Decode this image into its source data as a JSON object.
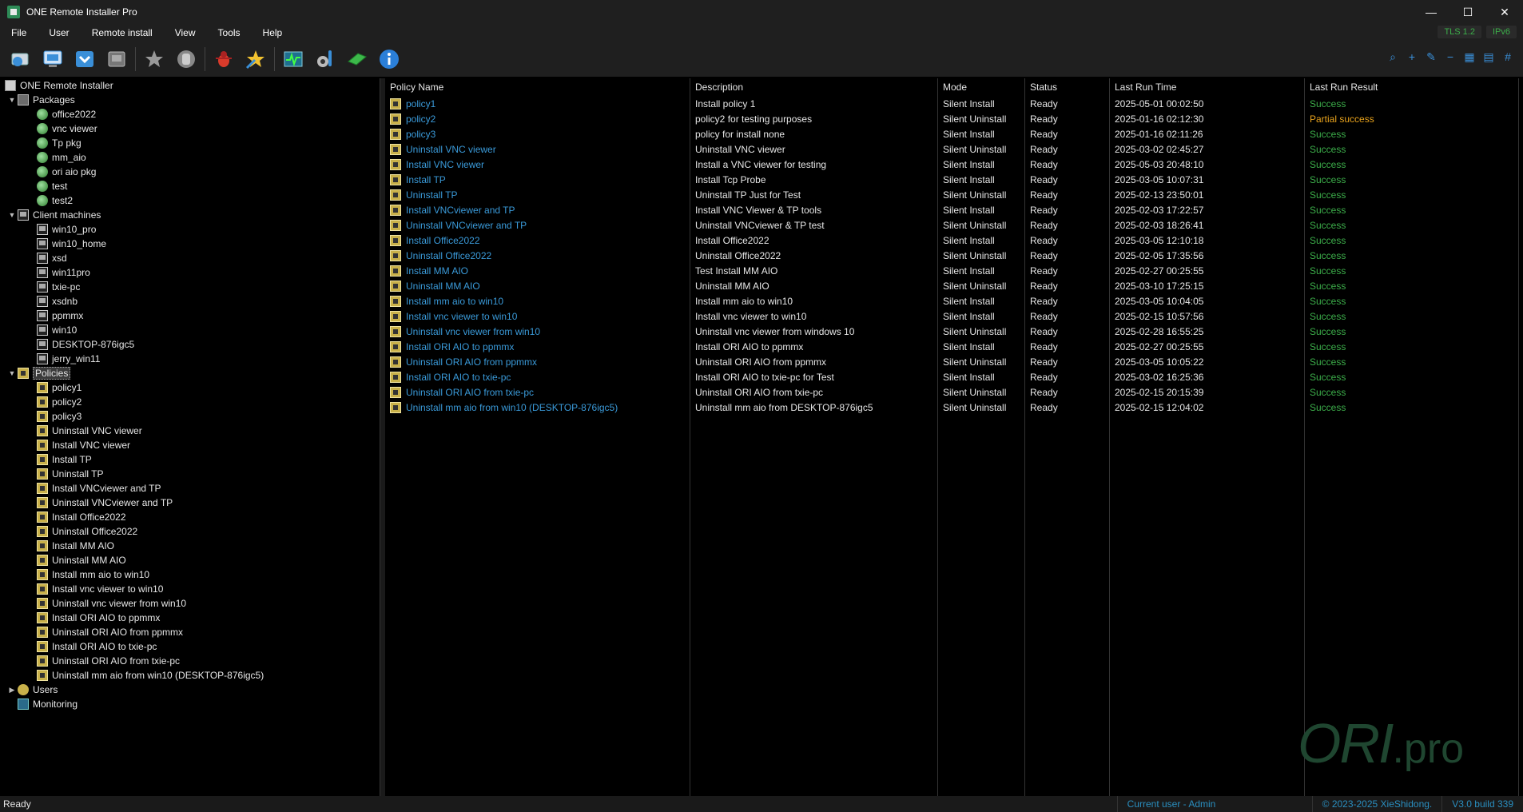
{
  "window": {
    "title": "ONE Remote Installer Pro",
    "minimize": "—",
    "maximize": "☐",
    "close": "✕"
  },
  "menu": [
    "File",
    "User",
    "Remote install",
    "View",
    "Tools",
    "Help"
  ],
  "badges": [
    "TLS 1.2",
    "IPv6"
  ],
  "toolbar": {
    "icons": [
      "discover-icon",
      "deploy-icon",
      "install-icon",
      "uninstall-icon",
      "favorite-icon",
      "stop-icon",
      "bug-icon",
      "star-icon",
      "monitor-icon",
      "settings-icon",
      "license-icon",
      "info-icon"
    ],
    "right_icons": [
      "search-icon",
      "add-icon",
      "edit-icon",
      "remove-icon",
      "large-grid-icon",
      "small-grid-icon",
      "hash-icon"
    ]
  },
  "tree": {
    "root": "ONE Remote Installer",
    "packages": {
      "label": "Packages",
      "items": [
        "office2022",
        "vnc viewer",
        "Tp pkg",
        "mm_aio",
        "ori aio pkg",
        "test",
        "test2"
      ]
    },
    "clients": {
      "label": "Client machines",
      "items": [
        "win10_pro",
        "win10_home",
        "xsd",
        "win11pro",
        "txie-pc",
        "xsdnb",
        "ppmmx",
        "win10",
        "DESKTOP-876igc5",
        "jerry_win11"
      ]
    },
    "policies": {
      "label": "Policies",
      "items": [
        "policy1",
        "policy2",
        "policy3",
        "Uninstall VNC viewer",
        "Install VNC viewer",
        "Install TP",
        "Uninstall TP",
        "Install VNCviewer and TP",
        "Uninstall VNCviewer and TP",
        "Install Office2022",
        "Uninstall Office2022",
        "Install MM AIO",
        "Uninstall MM AIO",
        "Install mm aio to win10",
        "Install vnc viewer to win10",
        "Uninstall vnc viewer from win10",
        "Install ORI AIO to ppmmx",
        "Uninstall ORI AIO from ppmmx",
        "Install ORI AIO to txie-pc",
        "Uninstall ORI AIO from txie-pc",
        "Uninstall mm aio from win10 (DESKTOP-876igc5)"
      ]
    },
    "users": "Users",
    "monitoring": "Monitoring"
  },
  "table": {
    "columns": [
      "Policy Name",
      "Description",
      "Mode",
      "Status",
      "Last Run Time",
      "Last Run Result"
    ],
    "rows": [
      [
        "policy1",
        "Install policy 1",
        "Silent Install",
        "Ready",
        "2025-05-01 00:02:50",
        "Success"
      ],
      [
        "policy2",
        "policy2 for testing purposes",
        "Silent Uninstall",
        "Ready",
        "2025-01-16 02:12:30",
        "Partial success"
      ],
      [
        "policy3",
        "policy for install none",
        "Silent Install",
        "Ready",
        "2025-01-16 02:11:26",
        "Success"
      ],
      [
        "Uninstall VNC viewer",
        "Uninstall VNC viewer",
        "Silent Uninstall",
        "Ready",
        "2025-03-02 02:45:27",
        "Success"
      ],
      [
        "Install VNC viewer",
        "Install a VNC viewer for testing",
        "Silent Install",
        "Ready",
        "2025-05-03 20:48:10",
        "Success"
      ],
      [
        "Install TP",
        "Install Tcp Probe",
        "Silent Install",
        "Ready",
        "2025-03-05 10:07:31",
        "Success"
      ],
      [
        "Uninstall TP",
        "Uninstall TP Just for Test",
        "Silent Uninstall",
        "Ready",
        "2025-02-13 23:50:01",
        "Success"
      ],
      [
        "Install VNCviewer and TP",
        "Install VNC Viewer & TP tools",
        "Silent Install",
        "Ready",
        "2025-02-03 17:22:57",
        "Success"
      ],
      [
        "Uninstall VNCviewer and TP",
        "Uninstall VNCviewer & TP test",
        "Silent Uninstall",
        "Ready",
        "2025-02-03 18:26:41",
        "Success"
      ],
      [
        "Install Office2022",
        "Install Office2022",
        "Silent Install",
        "Ready",
        "2025-03-05 12:10:18",
        "Success"
      ],
      [
        "Uninstall Office2022",
        "Uninstall Office2022",
        "Silent Uninstall",
        "Ready",
        "2025-02-05 17:35:56",
        "Success"
      ],
      [
        "Install MM AIO",
        "Test Install MM AIO",
        "Silent Install",
        "Ready",
        "2025-02-27 00:25:55",
        "Success"
      ],
      [
        "Uninstall MM AIO",
        "Uninstall MM AIO",
        "Silent Uninstall",
        "Ready",
        "2025-03-10 17:25:15",
        "Success"
      ],
      [
        "Install mm aio to win10",
        "Install mm aio to win10",
        "Silent Install",
        "Ready",
        "2025-03-05 10:04:05",
        "Success"
      ],
      [
        "Install vnc viewer to win10",
        "Install vnc viewer to win10",
        "Silent Install",
        "Ready",
        "2025-02-15 10:57:56",
        "Success"
      ],
      [
        "Uninstall vnc viewer from win10",
        "Uninstall vnc viewer from windows 10",
        "Silent Uninstall",
        "Ready",
        "2025-02-28 16:55:25",
        "Success"
      ],
      [
        "Install ORI AIO to ppmmx",
        "Install ORI AIO to ppmmx",
        "Silent Install",
        "Ready",
        "2025-02-27 00:25:55",
        "Success"
      ],
      [
        "Uninstall ORI AIO from ppmmx",
        "Uninstall ORI AIO from ppmmx",
        "Silent Uninstall",
        "Ready",
        "2025-03-05 10:05:22",
        "Success"
      ],
      [
        "Install ORI AIO to txie-pc",
        "Install ORI AIO to txie-pc for Test",
        "Silent Install",
        "Ready",
        "2025-03-02 16:25:36",
        "Success"
      ],
      [
        "Uninstall ORI AIO from txie-pc",
        "Uninstall ORI AIO from txie-pc",
        "Silent Uninstall",
        "Ready",
        "2025-02-15 20:15:39",
        "Success"
      ],
      [
        "Uninstall mm aio from win10 (DESKTOP-876igc5)",
        "Uninstall mm aio from DESKTOP-876igc5",
        "Silent Uninstall",
        "Ready",
        "2025-02-15 12:04:02",
        "Success"
      ]
    ]
  },
  "watermark": {
    "main": "ORI",
    "suffix": ".pro"
  },
  "status": {
    "left": "Ready",
    "user": "Current user - Admin",
    "copyright": "© 2023-2025 XieShidong.",
    "version": "V3.0 build 339"
  },
  "colors": {
    "link": "#3a9ad9",
    "success": "#3cae4a",
    "partial": "#e8a21c"
  }
}
